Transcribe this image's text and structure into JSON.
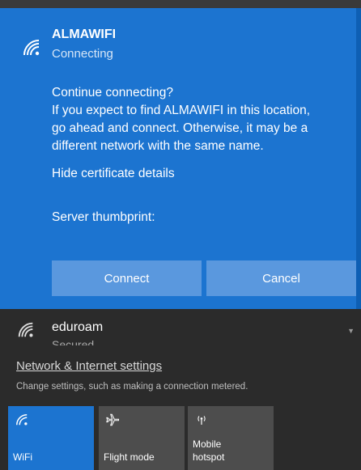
{
  "network": {
    "name": "ALMAWIFI",
    "status": "Connecting",
    "message_lines": [
      "Continue connecting?",
      "If you expect to find ALMAWIFI in this location,",
      "go ahead and connect. Otherwise, it may be a",
      "different network with the same name."
    ],
    "hide_link": "Hide certificate details",
    "thumbprint_label": "Server thumbprint:",
    "connect_label": "Connect",
    "cancel_label": "Cancel",
    "icon": "wifi-icon"
  },
  "other_network": {
    "name": "eduroam",
    "status": "Secured",
    "icon": "wifi-icon"
  },
  "settings": {
    "link": "Network & Internet settings",
    "desc": "Change settings, such as making a connection metered."
  },
  "tiles": [
    {
      "label": "WiFi",
      "icon": "wifi-icon",
      "active": true
    },
    {
      "label": "Flight mode",
      "icon": "airplane-icon",
      "active": false
    },
    {
      "label": "Mobile hotspot",
      "icon": "hotspot-icon",
      "active": false
    }
  ],
  "colors": {
    "accent": "#1c74d0",
    "button": "#5a98de",
    "background": "#2b2b2b",
    "tile_inactive": "#4d4d4d"
  }
}
